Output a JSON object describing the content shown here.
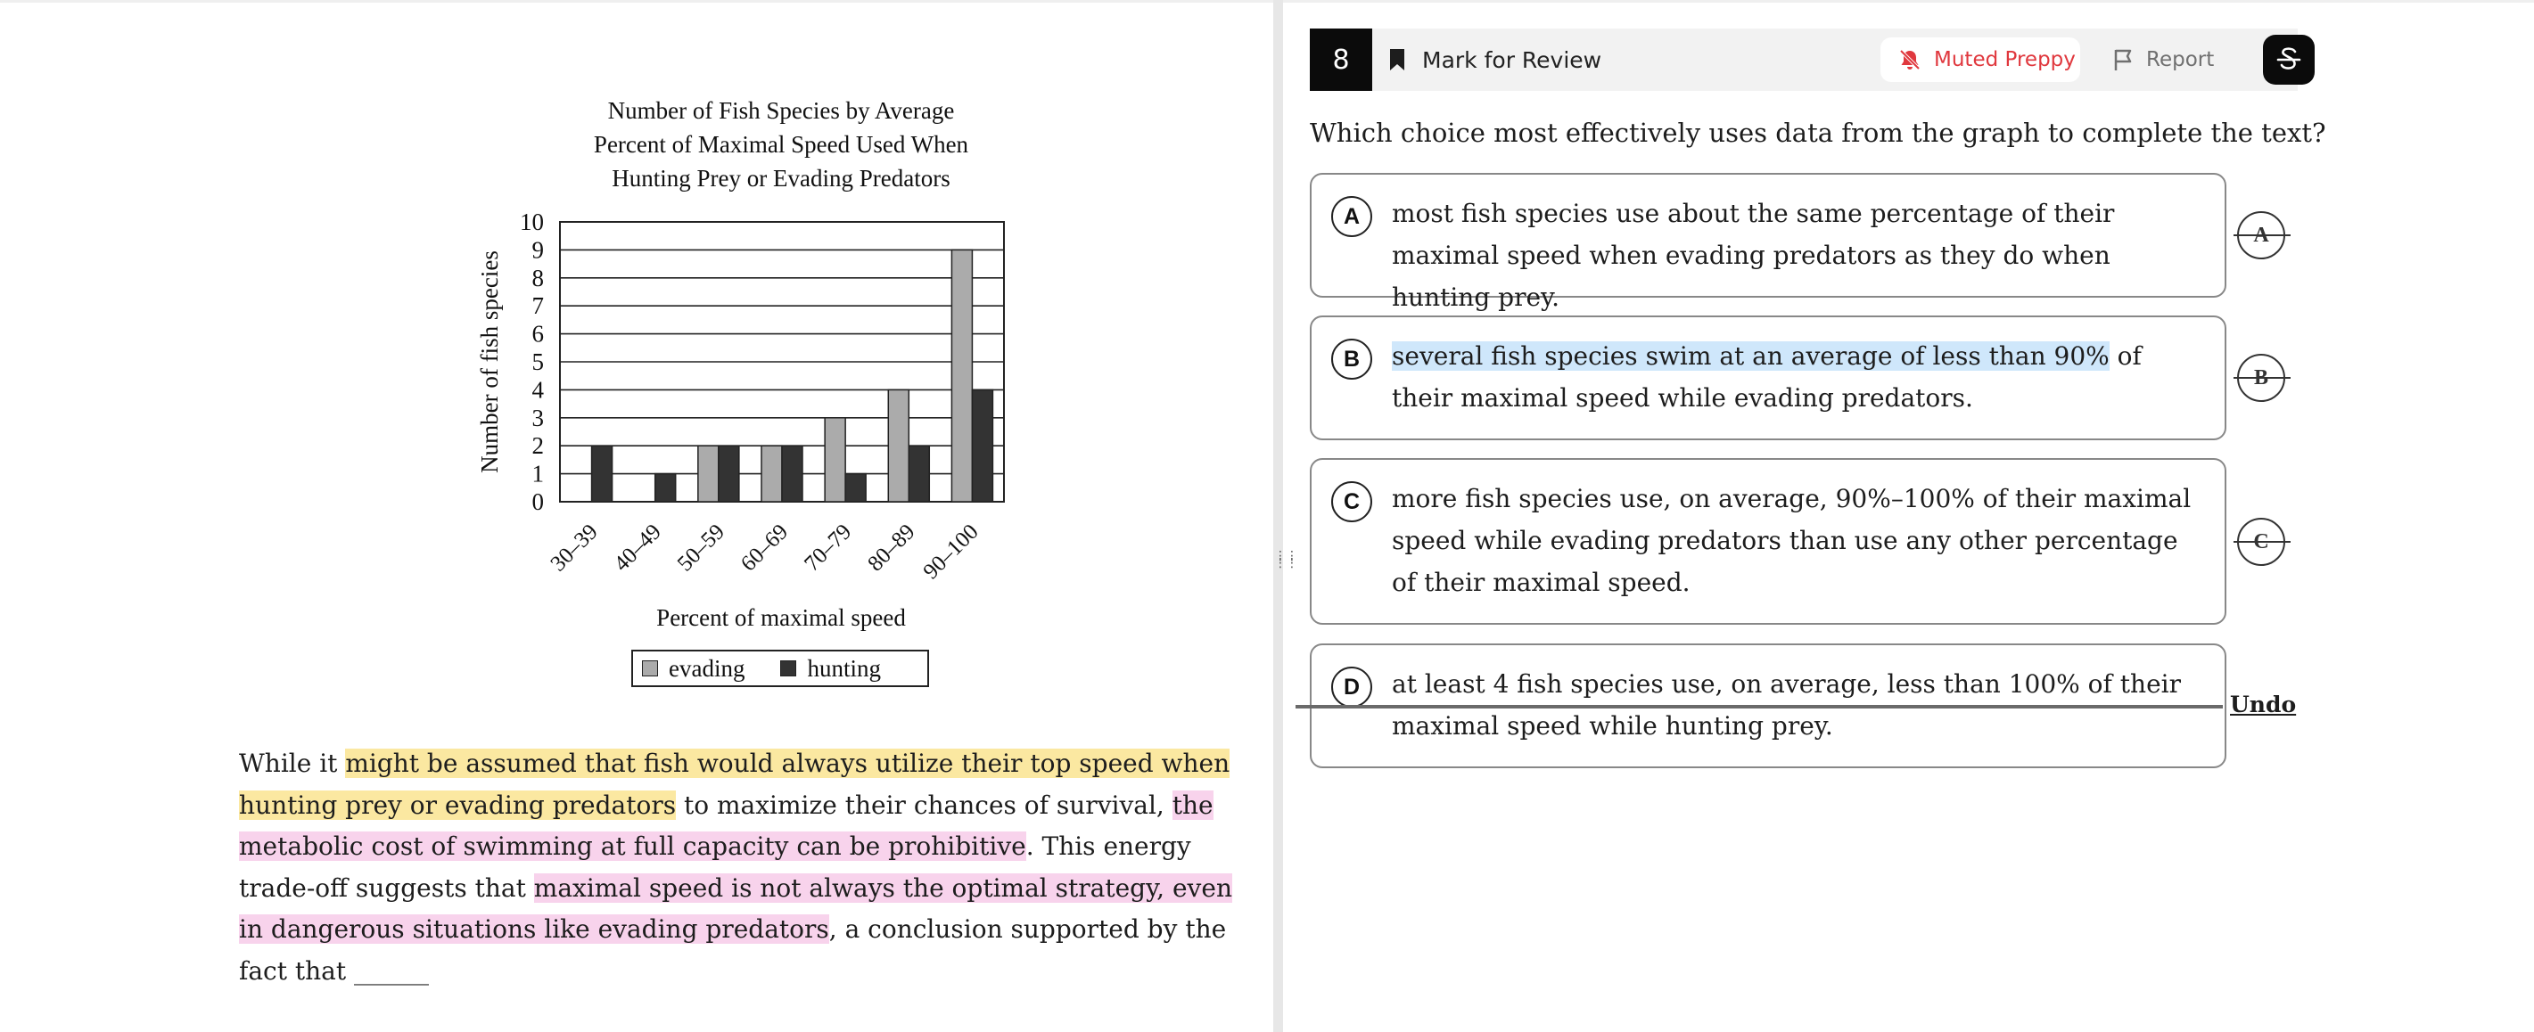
{
  "chart_data": {
    "type": "bar",
    "title": "Number of Fish Species by Average Percent of Maximal Speed Used When Hunting Prey or Evading Predators",
    "title_lines": [
      "Number of Fish Species by Average",
      "Percent of Maximal Speed Used When",
      "Hunting Prey or Evading Predators"
    ],
    "xlabel": "Percent of maximal speed",
    "ylabel": "Number of fish species",
    "categories": [
      "30–39",
      "40–49",
      "50–59",
      "60–69",
      "70–79",
      "80–89",
      "90–100"
    ],
    "series": [
      {
        "name": "evading",
        "color": "#ababab",
        "values": [
          0,
          0,
          2,
          2,
          3,
          4,
          9
        ]
      },
      {
        "name": "hunting",
        "color": "#333333",
        "values": [
          2,
          1,
          2,
          2,
          1,
          2,
          4
        ]
      }
    ],
    "ylim": [
      0,
      10
    ],
    "yticks": [
      "0",
      "1",
      "2",
      "3",
      "4",
      "5",
      "6",
      "7",
      "8",
      "9",
      "10"
    ],
    "grid": true,
    "legend_position": "bottom"
  },
  "passage": {
    "p1": "While it ",
    "h1": "might be assumed that fish would always utilize their top speed when hunting prey or evading predators",
    "p2": " to maximize their chances of survival, ",
    "h2": "the metabolic cost of swimming at full capacity can be prohibitive",
    "p3": ". This energy trade-off suggests that ",
    "h3": "maximal speed is not always the optimal strategy, even in dangerous situations like evading predators",
    "p4": ", a conclusion supported by the fact that ______"
  },
  "toolbar": {
    "question_number": "8",
    "mark_for_review": "Mark for Review",
    "muted_label": "Muted Preppy",
    "report_label": "Report"
  },
  "question": {
    "stem": "Which choice most effectively uses data from the graph to complete the text?"
  },
  "choices": [
    {
      "letter": "A",
      "text": "most fish species use about the same percentage of their maximal speed when evading predators as they do when hunting prey."
    },
    {
      "letter": "B",
      "highlight": "several fish species swim at an average of less than 90%",
      "rest": " of their maximal speed while evading predators."
    },
    {
      "letter": "C",
      "text": "more fish species use, on average, 90%–100% of their maximal speed while evading predators than use any other percentage of their maximal speed."
    },
    {
      "letter": "D",
      "text": "at least 4 fish species use, on average, less than 100% of their maximal speed while hunting prey."
    }
  ],
  "undo_label": "Undo",
  "colors": {
    "accent_red": "#e0383e",
    "highlight_yellow": "#fbe8a1",
    "highlight_pink": "#f8d3ec",
    "highlight_blue": "#cfe7fb"
  }
}
